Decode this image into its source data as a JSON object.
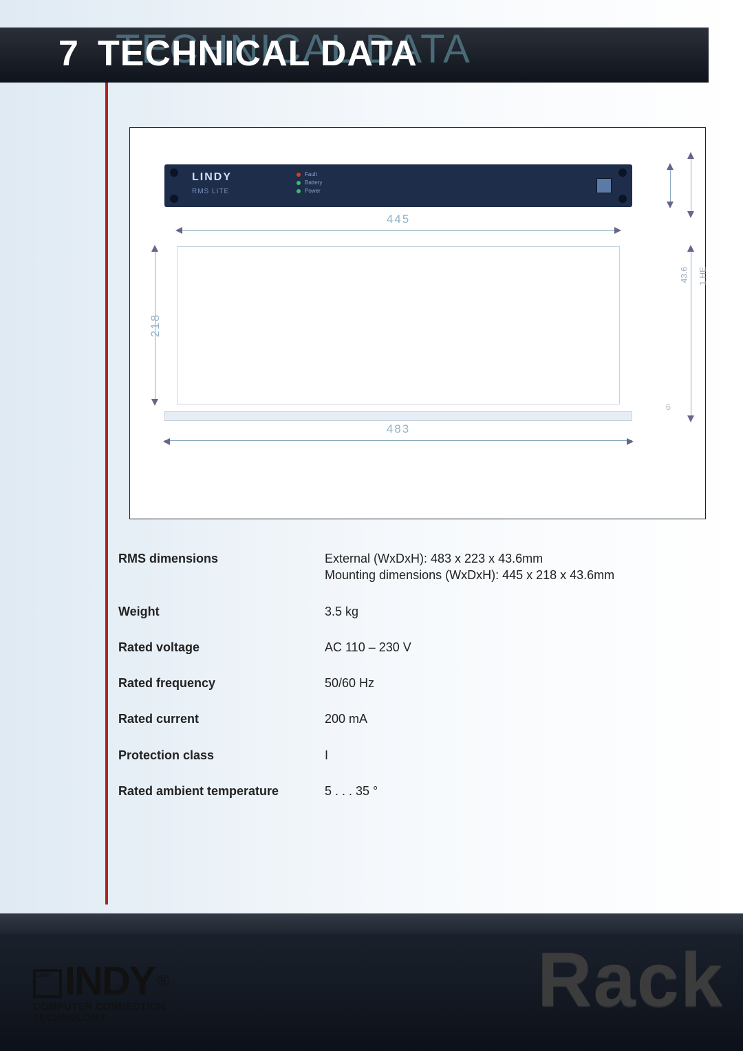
{
  "section_number": "7",
  "section_title": "TECHNICAL DATA",
  "section_title_shadow": "TECHNICAL DATA",
  "device": {
    "brand": "LINDY",
    "model": "RMS LITE",
    "leds": [
      {
        "color": "#d43d2a",
        "label": "Fault"
      },
      {
        "color": "#39c06b",
        "label": "Battery"
      },
      {
        "color": "#39c06b",
        "label": "Power"
      }
    ]
  },
  "diagram": {
    "width_inner": "445",
    "depth": "218",
    "width_outer": "483",
    "height_outer": "1 HE",
    "height_inner": "43.6",
    "small_dim": "6"
  },
  "specs": [
    {
      "label": "RMS dimensions",
      "value_line1": "External (WxDxH): 483 x 223 x 43.6mm",
      "value_line2": "Mounting dimensions (WxDxH): 445 x 218 x 43.6mm"
    },
    {
      "label": "Weight",
      "value_line1": "3.5 kg",
      "value_line2": ""
    },
    {
      "label": "Rated voltage",
      "value_line1": "AC 110 – 230 V",
      "value_line2": ""
    },
    {
      "label": "Rated frequency",
      "value_line1": "50/60 Hz",
      "value_line2": ""
    },
    {
      "label": "Rated current",
      "value_line1": "200 mA",
      "value_line2": ""
    },
    {
      "label": "Protection class",
      "value_line1": "I",
      "value_line2": ""
    },
    {
      "label": "Rated ambient temperature",
      "value_line1": "5 . . . 35 °",
      "value_line2": ""
    }
  ],
  "footer": {
    "word": "Rack",
    "logo_text": "INDY",
    "registered": "®",
    "tagline_bold": "COMPUTER CONNECTION TECHNOLOGY"
  }
}
